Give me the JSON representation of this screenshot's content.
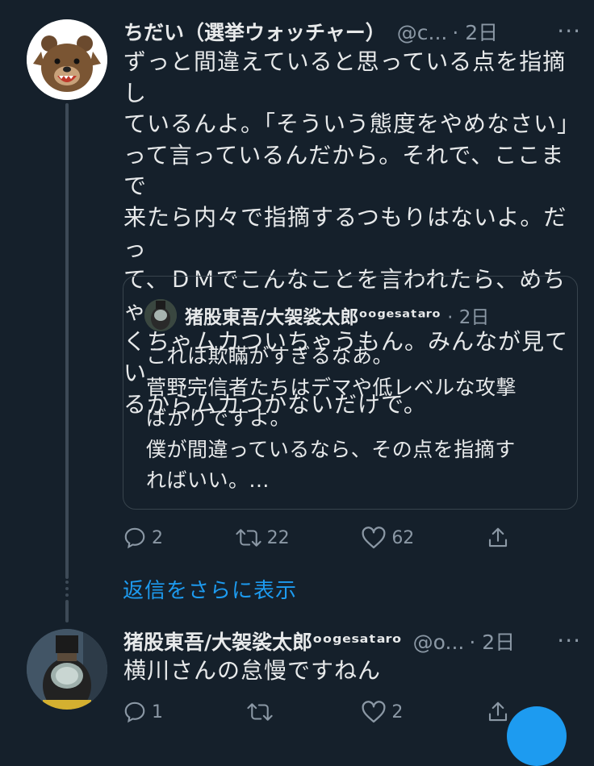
{
  "tweet1": {
    "name": "ちだい（選挙ウォッチャー）",
    "handle": "@c...",
    "time": "· 2日",
    "more": "···",
    "text": "ずっと間違えていると思っている点を指摘し\nているんよ。「そういう態度をやめなさい」\nって言っているんだから。それで、ここまで\n来たら内々で指摘するつもりはないよ。だっ\nて、ＤＭでこんなことを言われたら、めちゃ\nくちゃムカついちゃうもん。みんなが見てい\nるからムカつかないだけで。",
    "quote": {
      "name": "猪股東吾/大袈裟太郎ᵒᵒᵍᵉˢᵃᵗᵃʳᵒ",
      "time": "· 2日",
      "text": "これは欺瞞がすぎるなあ。\n菅野完信者たちはデマや低レベルな攻撃\nばかりですよ。\n僕が間違っているなら、その点を指摘す\nればいい。..."
    },
    "actions": {
      "reply": "2",
      "retweet": "22",
      "like": "62"
    }
  },
  "show_replies": "返信をさらに表示",
  "tweet2": {
    "name": "猪股東吾/大袈裟太郎ᵒᵒᵍᵉˢᵃᵗᵃʳᵒ",
    "handle": "@o...",
    "time": "· 2日",
    "more": "···",
    "text": "横川さんの怠慢ですねん",
    "actions": {
      "reply": "1",
      "retweet": "",
      "like": "2"
    }
  },
  "colors": {
    "background": "#15202b",
    "text": "#e7e9ea",
    "secondary": "#8b98a5",
    "accent": "#1d9bf0"
  }
}
